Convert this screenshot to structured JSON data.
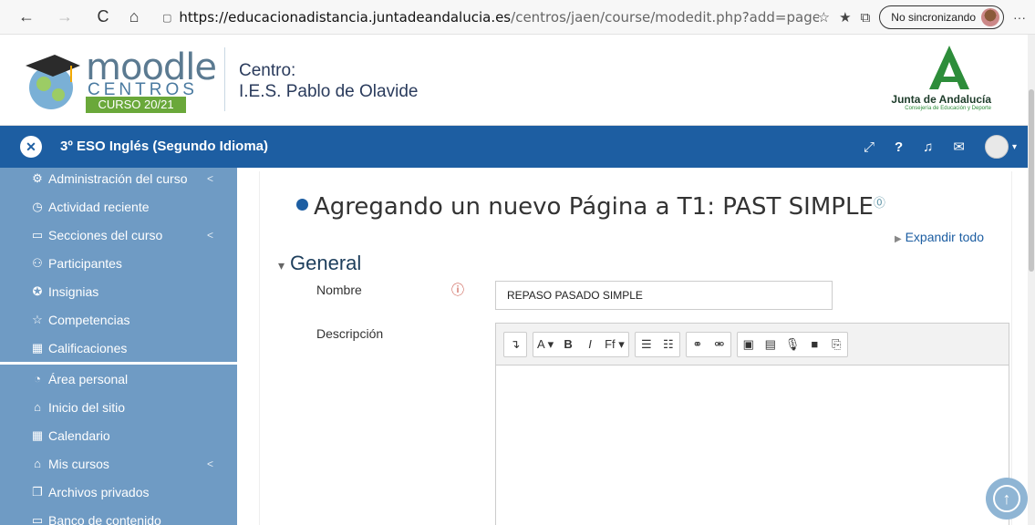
{
  "browser": {
    "back": "←",
    "forward": "→",
    "reload": "C",
    "home": "⌂",
    "lock": "🔒",
    "url_host": "https://educacionadistancia.juntadeandalucia.es",
    "url_path": "/centros/jaen/course/modedit.php?add=page&ty...",
    "sync_label": "No sincronizando",
    "more": "···"
  },
  "header": {
    "logo_text": "moodle",
    "logo_centros": "CENTROS",
    "logo_curso": "CURSO 20/21",
    "centro_label": "Centro:",
    "centro_name": "I.E.S. Pablo de Olavide",
    "junta_name": "Junta de Andalucía",
    "junta_sub": "Consejería de Educación y Deporte"
  },
  "navbar": {
    "course_title": "3º ESO Inglés (Segundo Idioma)"
  },
  "sidebar": {
    "items": [
      {
        "label": "Administración del curso",
        "icon": "gears-icon",
        "glyph": "⚙",
        "chev": "<"
      },
      {
        "label": "Actividad reciente",
        "icon": "clock-icon",
        "glyph": "◷",
        "chev": ""
      },
      {
        "label": "Secciones del curso",
        "icon": "folder-icon",
        "glyph": "▭",
        "chev": "<"
      },
      {
        "label": "Participantes",
        "icon": "users-icon",
        "glyph": "⚇",
        "chev": ""
      },
      {
        "label": "Insignias",
        "icon": "badge-icon",
        "glyph": "✪",
        "chev": ""
      },
      {
        "label": "Competencias",
        "icon": "star-icon",
        "glyph": "☆",
        "chev": ""
      },
      {
        "label": "Calificaciones",
        "icon": "grades-icon",
        "glyph": "▦",
        "chev": ""
      }
    ],
    "items2": [
      {
        "label": "Área personal",
        "icon": "dashboard-icon",
        "glyph": "◔",
        "chev": ""
      },
      {
        "label": "Inicio del sitio",
        "icon": "home-icon",
        "glyph": "⌂",
        "chev": ""
      },
      {
        "label": "Calendario",
        "icon": "calendar-icon",
        "glyph": "▦",
        "chev": ""
      },
      {
        "label": "Mis cursos",
        "icon": "graduation-cap-icon",
        "glyph": "⌂",
        "chev": "<"
      },
      {
        "label": "Archivos privados",
        "icon": "files-icon",
        "glyph": "❐",
        "chev": ""
      },
      {
        "label": "Banco de contenido",
        "icon": "content-bank-icon",
        "glyph": "▭",
        "chev": ""
      }
    ]
  },
  "main": {
    "heading": "Agregando un nuevo Página a T1: PAST SIMPLE",
    "expand_all": "Expandir todo",
    "section": "General",
    "label_nombre": "Nombre",
    "nombre_value": "REPASO PASADO SIMPLE",
    "label_descripcion": "Descripción"
  },
  "editor_toolbar": [
    [
      "↴"
    ],
    [
      "A ▾",
      "B",
      "I",
      "Ff ▾"
    ],
    [
      "☰",
      "☷"
    ],
    [
      "⚭",
      "⚮"
    ],
    [
      "▣",
      "▤",
      "🎙",
      "■",
      "⎘"
    ]
  ],
  "colors": {
    "navbar": "#1d5ea2",
    "sidebar": "#6f9bc4",
    "logo_green": "#6aa83a"
  }
}
